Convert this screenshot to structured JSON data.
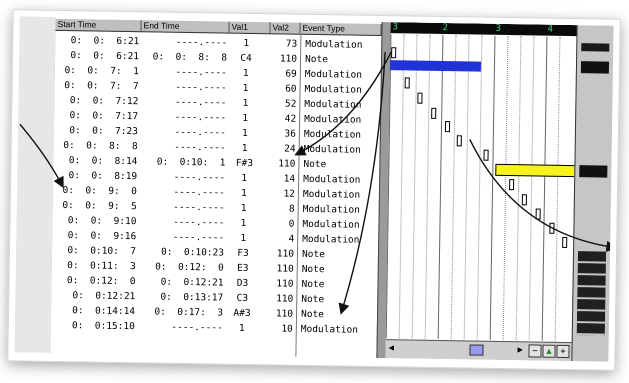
{
  "list": {
    "headers": {
      "start": "Start Time",
      "end": "End Time",
      "val1": "Val1",
      "val2": "Val2",
      "type": "Event Type"
    },
    "rows": [
      {
        "start": "0:  0:  6:21",
        "end": "----.----",
        "val1": "1",
        "val2": "73",
        "type": "Modulation"
      },
      {
        "start": "0:  0:  6:21",
        "end": "0:  0:  8:  8",
        "val1": "C4",
        "val2": "110",
        "type": "Note"
      },
      {
        "start": "0:  0:  7:  1",
        "end": "----.----",
        "val1": "1",
        "val2": "69",
        "type": "Modulation"
      },
      {
        "start": "0:  0:  7:  7",
        "end": "----.----",
        "val1": "1",
        "val2": "60",
        "type": "Modulation"
      },
      {
        "start": "0:  0:  7:12",
        "end": "----.----",
        "val1": "1",
        "val2": "52",
        "type": "Modulation"
      },
      {
        "start": "0:  0:  7:17",
        "end": "----.----",
        "val1": "1",
        "val2": "42",
        "type": "Modulation"
      },
      {
        "start": "0:  0:  7:23",
        "end": "----.----",
        "val1": "1",
        "val2": "36",
        "type": "Modulation"
      },
      {
        "start": "0:  0:  8:  8",
        "end": "----.----",
        "val1": "1",
        "val2": "24",
        "type": "Modulation"
      },
      {
        "start": "0:  0:  8:14",
        "end": "0:  0:10:  1",
        "val1": "F#3",
        "val2": "110",
        "type": "Note"
      },
      {
        "start": "0:  0:  8:19",
        "end": "----.----",
        "val1": "1",
        "val2": "14",
        "type": "Modulation"
      },
      {
        "start": "0:  0:  9:  0",
        "end": "----.----",
        "val1": "1",
        "val2": "12",
        "type": "Modulation"
      },
      {
        "start": "0:  0:  9:  5",
        "end": "----.----",
        "val1": "1",
        "val2": "8",
        "type": "Modulation"
      },
      {
        "start": "0:  0:  9:10",
        "end": "----.----",
        "val1": "1",
        "val2": "0",
        "type": "Modulation"
      },
      {
        "start": "0:  0:  9:16",
        "end": "----.----",
        "val1": "1",
        "val2": "4",
        "type": "Modulation"
      },
      {
        "start": "0:  0:10:  7",
        "end": "0:  0:10:23",
        "val1": "F3",
        "val2": "110",
        "type": "Note"
      },
      {
        "start": "0:  0:11:  3",
        "end": "0:  0:12:  0",
        "val1": "E3",
        "val2": "110",
        "type": "Note"
      },
      {
        "start": "0:  0:12:  0",
        "end": "0:  0:12:21",
        "val1": "D3",
        "val2": "110",
        "type": "Note"
      },
      {
        "start": "0:  0:12:21",
        "end": "0:  0:13:17",
        "val1": "C3",
        "val2": "110",
        "type": "Note"
      },
      {
        "start": "0:  0:14:14",
        "end": "0:  0:17:  3",
        "val1": "A#3",
        "val2": "110",
        "type": "Note"
      },
      {
        "start": "0:  0:15:10",
        "end": "----.----",
        "val1": "1",
        "val2": "10",
        "type": "Modulation"
      }
    ]
  },
  "roll": {
    "ruler_labels": [
      "3",
      "2",
      "3",
      "4"
    ],
    "note_colors": {
      "c4": "#1f33d6",
      "fsharp3": "#f5f21c"
    },
    "scroll": {
      "left_arrow": "◀",
      "right_arrow": "▶",
      "zoom_out": "−",
      "zoom_in": "▲",
      "zoom_plus": "+"
    }
  },
  "icons": {
    "arrow_marker": "arrow-icon"
  }
}
